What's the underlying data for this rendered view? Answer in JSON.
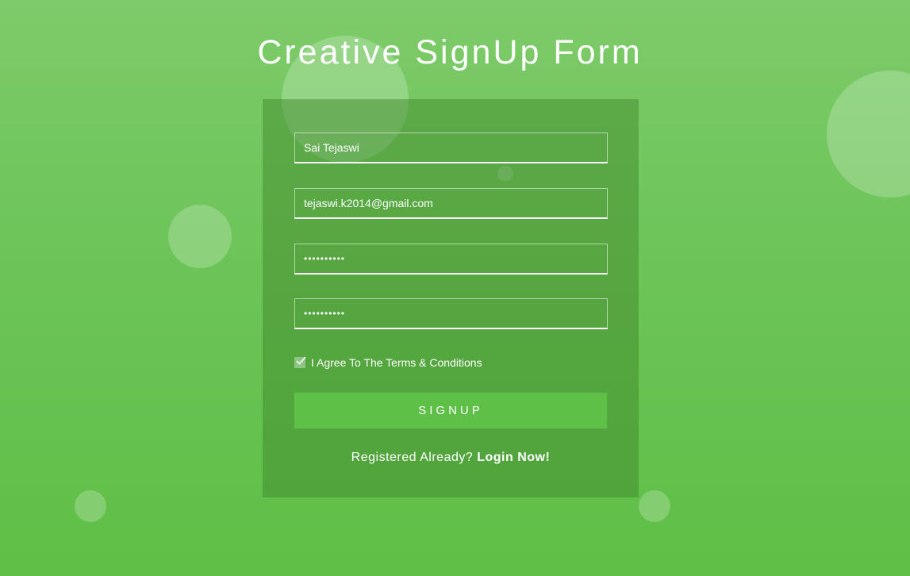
{
  "title": "Creative SignUp Form",
  "form": {
    "name_value": "Sai Tejaswi",
    "email_value": "tejaswi.k2014@gmail.com",
    "password_value": "••••••••••",
    "confirm_password_value": "••••••••••",
    "terms_checked": true,
    "terms_label": "I Agree To The Terms & Conditions",
    "signup_label": "SIGNUP",
    "registered_text": "Registered Already?",
    "login_link": "Login Now!"
  },
  "colors": {
    "background_top": "#7dcb6a",
    "background_bottom": "#5fbf46",
    "button": "#5ec046",
    "text": "#ffffff"
  }
}
